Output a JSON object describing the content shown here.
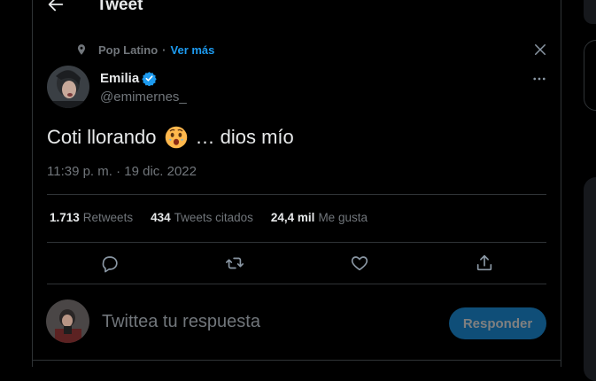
{
  "header": {
    "title": "Tweet"
  },
  "context": {
    "label": "Pop Latino",
    "separator": "·",
    "more_label": "Ver más"
  },
  "author": {
    "name": "Emilia",
    "handle": "@emimernes_"
  },
  "tweet": {
    "text": "Coti llorando",
    "suffix": "… dios mío",
    "timestamp": "11:39 p. m. · 19 dic. 2022"
  },
  "stats": [
    {
      "count": "1.713",
      "label": "Retweets"
    },
    {
      "count": "434",
      "label": "Tweets citados"
    },
    {
      "count": "24,4 mil",
      "label": "Me gusta"
    }
  ],
  "reply": {
    "placeholder": "Twittea tu respuesta",
    "button_label": "Responder"
  },
  "colors": {
    "accent": "#1d9bf0",
    "muted": "#71767b",
    "border": "#2f3336",
    "background": "#000000",
    "button_bg": "#0f4e78"
  },
  "icons": [
    "back-arrow-icon",
    "location-pin-icon",
    "close-icon",
    "verified-badge-icon",
    "more-options-icon",
    "reply-icon",
    "retweet-icon",
    "like-icon",
    "share-icon"
  ]
}
